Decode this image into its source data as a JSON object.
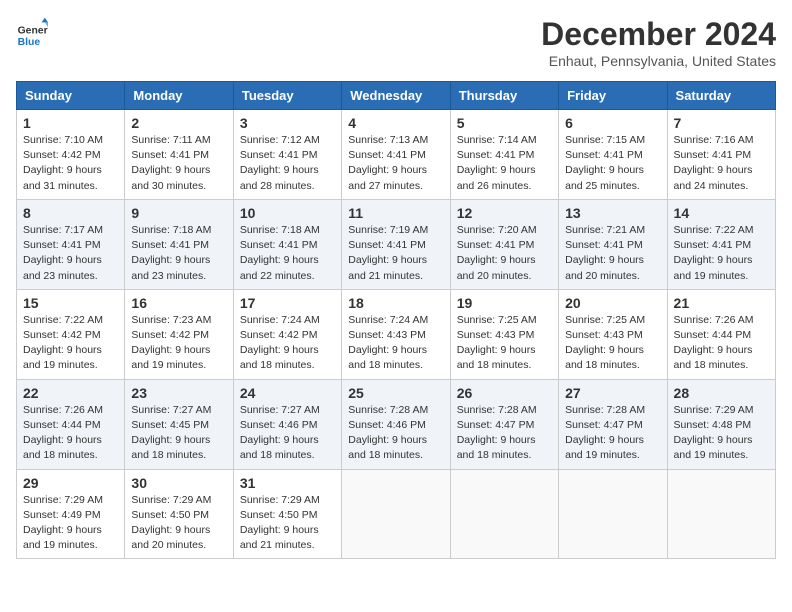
{
  "header": {
    "logo_line1": "General",
    "logo_line2": "Blue",
    "month": "December 2024",
    "location": "Enhaut, Pennsylvania, United States"
  },
  "weekdays": [
    "Sunday",
    "Monday",
    "Tuesday",
    "Wednesday",
    "Thursday",
    "Friday",
    "Saturday"
  ],
  "weeks": [
    [
      {
        "day": "1",
        "sunrise": "Sunrise: 7:10 AM",
        "sunset": "Sunset: 4:42 PM",
        "daylight": "Daylight: 9 hours and 31 minutes."
      },
      {
        "day": "2",
        "sunrise": "Sunrise: 7:11 AM",
        "sunset": "Sunset: 4:41 PM",
        "daylight": "Daylight: 9 hours and 30 minutes."
      },
      {
        "day": "3",
        "sunrise": "Sunrise: 7:12 AM",
        "sunset": "Sunset: 4:41 PM",
        "daylight": "Daylight: 9 hours and 28 minutes."
      },
      {
        "day": "4",
        "sunrise": "Sunrise: 7:13 AM",
        "sunset": "Sunset: 4:41 PM",
        "daylight": "Daylight: 9 hours and 27 minutes."
      },
      {
        "day": "5",
        "sunrise": "Sunrise: 7:14 AM",
        "sunset": "Sunset: 4:41 PM",
        "daylight": "Daylight: 9 hours and 26 minutes."
      },
      {
        "day": "6",
        "sunrise": "Sunrise: 7:15 AM",
        "sunset": "Sunset: 4:41 PM",
        "daylight": "Daylight: 9 hours and 25 minutes."
      },
      {
        "day": "7",
        "sunrise": "Sunrise: 7:16 AM",
        "sunset": "Sunset: 4:41 PM",
        "daylight": "Daylight: 9 hours and 24 minutes."
      }
    ],
    [
      {
        "day": "8",
        "sunrise": "Sunrise: 7:17 AM",
        "sunset": "Sunset: 4:41 PM",
        "daylight": "Daylight: 9 hours and 23 minutes."
      },
      {
        "day": "9",
        "sunrise": "Sunrise: 7:18 AM",
        "sunset": "Sunset: 4:41 PM",
        "daylight": "Daylight: 9 hours and 23 minutes."
      },
      {
        "day": "10",
        "sunrise": "Sunrise: 7:18 AM",
        "sunset": "Sunset: 4:41 PM",
        "daylight": "Daylight: 9 hours and 22 minutes."
      },
      {
        "day": "11",
        "sunrise": "Sunrise: 7:19 AM",
        "sunset": "Sunset: 4:41 PM",
        "daylight": "Daylight: 9 hours and 21 minutes."
      },
      {
        "day": "12",
        "sunrise": "Sunrise: 7:20 AM",
        "sunset": "Sunset: 4:41 PM",
        "daylight": "Daylight: 9 hours and 20 minutes."
      },
      {
        "day": "13",
        "sunrise": "Sunrise: 7:21 AM",
        "sunset": "Sunset: 4:41 PM",
        "daylight": "Daylight: 9 hours and 20 minutes."
      },
      {
        "day": "14",
        "sunrise": "Sunrise: 7:22 AM",
        "sunset": "Sunset: 4:41 PM",
        "daylight": "Daylight: 9 hours and 19 minutes."
      }
    ],
    [
      {
        "day": "15",
        "sunrise": "Sunrise: 7:22 AM",
        "sunset": "Sunset: 4:42 PM",
        "daylight": "Daylight: 9 hours and 19 minutes."
      },
      {
        "day": "16",
        "sunrise": "Sunrise: 7:23 AM",
        "sunset": "Sunset: 4:42 PM",
        "daylight": "Daylight: 9 hours and 19 minutes."
      },
      {
        "day": "17",
        "sunrise": "Sunrise: 7:24 AM",
        "sunset": "Sunset: 4:42 PM",
        "daylight": "Daylight: 9 hours and 18 minutes."
      },
      {
        "day": "18",
        "sunrise": "Sunrise: 7:24 AM",
        "sunset": "Sunset: 4:43 PM",
        "daylight": "Daylight: 9 hours and 18 minutes."
      },
      {
        "day": "19",
        "sunrise": "Sunrise: 7:25 AM",
        "sunset": "Sunset: 4:43 PM",
        "daylight": "Daylight: 9 hours and 18 minutes."
      },
      {
        "day": "20",
        "sunrise": "Sunrise: 7:25 AM",
        "sunset": "Sunset: 4:43 PM",
        "daylight": "Daylight: 9 hours and 18 minutes."
      },
      {
        "day": "21",
        "sunrise": "Sunrise: 7:26 AM",
        "sunset": "Sunset: 4:44 PM",
        "daylight": "Daylight: 9 hours and 18 minutes."
      }
    ],
    [
      {
        "day": "22",
        "sunrise": "Sunrise: 7:26 AM",
        "sunset": "Sunset: 4:44 PM",
        "daylight": "Daylight: 9 hours and 18 minutes."
      },
      {
        "day": "23",
        "sunrise": "Sunrise: 7:27 AM",
        "sunset": "Sunset: 4:45 PM",
        "daylight": "Daylight: 9 hours and 18 minutes."
      },
      {
        "day": "24",
        "sunrise": "Sunrise: 7:27 AM",
        "sunset": "Sunset: 4:46 PM",
        "daylight": "Daylight: 9 hours and 18 minutes."
      },
      {
        "day": "25",
        "sunrise": "Sunrise: 7:28 AM",
        "sunset": "Sunset: 4:46 PM",
        "daylight": "Daylight: 9 hours and 18 minutes."
      },
      {
        "day": "26",
        "sunrise": "Sunrise: 7:28 AM",
        "sunset": "Sunset: 4:47 PM",
        "daylight": "Daylight: 9 hours and 18 minutes."
      },
      {
        "day": "27",
        "sunrise": "Sunrise: 7:28 AM",
        "sunset": "Sunset: 4:47 PM",
        "daylight": "Daylight: 9 hours and 19 minutes."
      },
      {
        "day": "28",
        "sunrise": "Sunrise: 7:29 AM",
        "sunset": "Sunset: 4:48 PM",
        "daylight": "Daylight: 9 hours and 19 minutes."
      }
    ],
    [
      {
        "day": "29",
        "sunrise": "Sunrise: 7:29 AM",
        "sunset": "Sunset: 4:49 PM",
        "daylight": "Daylight: 9 hours and 19 minutes."
      },
      {
        "day": "30",
        "sunrise": "Sunrise: 7:29 AM",
        "sunset": "Sunset: 4:50 PM",
        "daylight": "Daylight: 9 hours and 20 minutes."
      },
      {
        "day": "31",
        "sunrise": "Sunrise: 7:29 AM",
        "sunset": "Sunset: 4:50 PM",
        "daylight": "Daylight: 9 hours and 21 minutes."
      },
      null,
      null,
      null,
      null
    ]
  ]
}
